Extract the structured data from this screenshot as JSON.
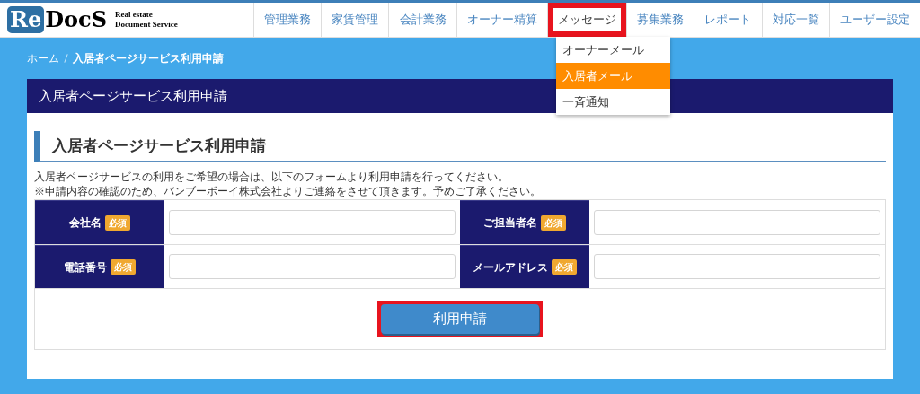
{
  "logo": {
    "mark": "Re",
    "name": "DocS",
    "tagline_1": "Real estate",
    "tagline_2": "Document Service"
  },
  "nav": [
    {
      "label": "管理業務",
      "selected": false,
      "highlighted": false
    },
    {
      "label": "家賃管理",
      "selected": false,
      "highlighted": false
    },
    {
      "label": "会計業務",
      "selected": false,
      "highlighted": false
    },
    {
      "label": "オーナー精算",
      "selected": false,
      "highlighted": false
    },
    {
      "label": "メッセージ",
      "selected": true,
      "highlighted": true,
      "menu": [
        {
          "label": "オーナーメール",
          "selected": false
        },
        {
          "label": "入居者メール",
          "selected": true
        },
        {
          "label": "一斉通知",
          "selected": false
        }
      ]
    },
    {
      "label": "募集業務",
      "selected": false,
      "highlighted": false
    },
    {
      "label": "レポート",
      "selected": false,
      "highlighted": false
    },
    {
      "label": "対応一覧",
      "selected": false,
      "highlighted": false
    },
    {
      "label": "ユーザー設定",
      "selected": false,
      "highlighted": false
    }
  ],
  "breadcrumb": [
    "ホーム",
    "入居者ページサービス利用申請"
  ],
  "card": {
    "title": "入居者ページサービス利用申請",
    "heading": "入居者ページサービス利用申請",
    "intro": [
      "入居者ページサービスの利用をご希望の場合は、以下のフォームより利用申請を行ってください。",
      "※申請内容の確認のため、バンブーボーイ株式会社よりご連絡をさせて頂きます。予めご了承ください。"
    ],
    "fields": [
      [
        {
          "label": "会社名",
          "required": "必須"
        },
        {
          "label": "ご担当者名",
          "required": "必須"
        }
      ],
      [
        {
          "label": "電話番号",
          "required": "必須"
        },
        {
          "label": "メールアドレス",
          "required": "必須"
        }
      ]
    ],
    "submit": {
      "label": "利用申請",
      "highlighted": true
    }
  }
}
